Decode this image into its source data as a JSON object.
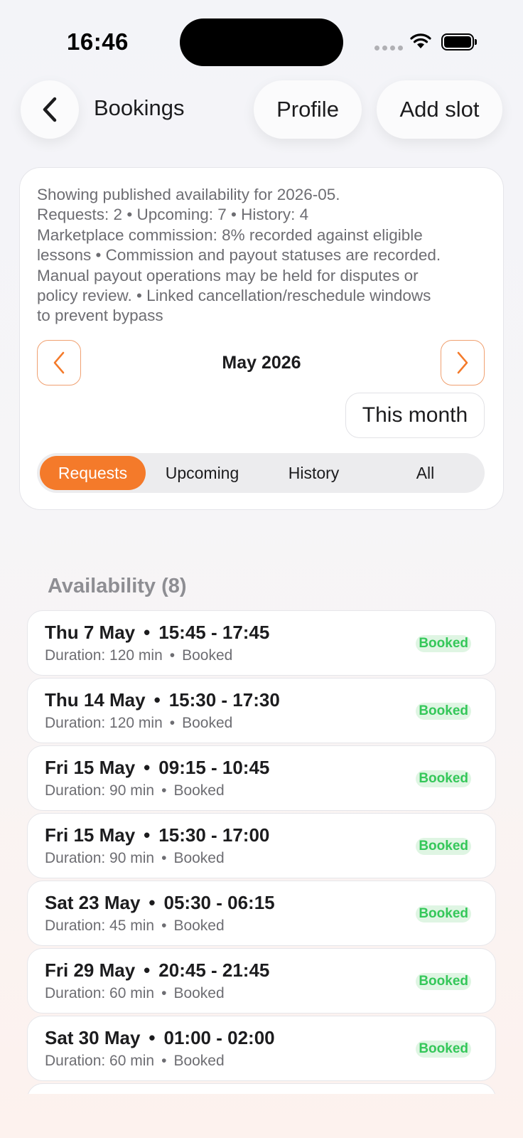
{
  "status_bar": {
    "time": "16:46"
  },
  "header": {
    "title": "Bookings",
    "profile_label": "Profile",
    "add_slot_label": "Add slot"
  },
  "info": {
    "lines": [
      "Showing published availability for 2026-05.",
      "Requests: 2 • Upcoming: 7 • History: 4",
      "Marketplace commission: 8% recorded against eligible",
      "lessons • Commission and payout statuses are recorded.",
      "Manual payout operations may be held for disputes or",
      "policy review. • Linked cancellation/reschedule windows",
      "to prevent bypass"
    ],
    "month": "May 2026",
    "this_month_label": "This month"
  },
  "tabs": [
    {
      "label": "Requests",
      "active": true
    },
    {
      "label": "Upcoming",
      "active": false
    },
    {
      "label": "History",
      "active": false
    },
    {
      "label": "All",
      "active": false
    }
  ],
  "availability": {
    "title": "Availability (8)",
    "slots": [
      {
        "date": "Thu 7 May",
        "time": "15:45 - 17:45",
        "duration": "Duration: 120 min",
        "status": "Booked",
        "badge": "Booked"
      },
      {
        "date": "Thu 14 May",
        "time": "15:30 - 17:30",
        "duration": "Duration: 120 min",
        "status": "Booked",
        "badge": "Booked"
      },
      {
        "date": "Fri 15 May",
        "time": "09:15 - 10:45",
        "duration": "Duration: 90 min",
        "status": "Booked",
        "badge": "Booked"
      },
      {
        "date": "Fri 15 May",
        "time": "15:30 - 17:00",
        "duration": "Duration: 90 min",
        "status": "Booked",
        "badge": "Booked"
      },
      {
        "date": "Sat 23 May",
        "time": "05:30 - 06:15",
        "duration": "Duration: 45 min",
        "status": "Booked",
        "badge": "Booked"
      },
      {
        "date": "Fri 29 May",
        "time": "20:45 - 21:45",
        "duration": "Duration: 60 min",
        "status": "Booked",
        "badge": "Booked"
      },
      {
        "date": "Sat 30 May",
        "time": "01:00 - 02:00",
        "duration": "Duration: 60 min",
        "status": "Booked",
        "badge": "Booked"
      }
    ]
  },
  "colors": {
    "accent": "#f47a2a",
    "booked_text": "#34c759",
    "booked_bg": "#dff5e3"
  }
}
